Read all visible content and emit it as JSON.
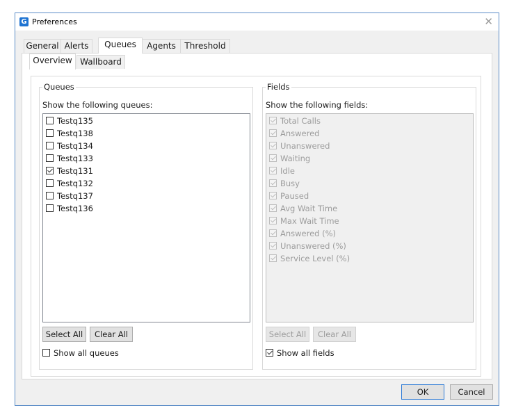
{
  "window": {
    "title": "Preferences",
    "app_icon": "G",
    "close_glyph": "✕"
  },
  "tabs": [
    {
      "label": "General",
      "active": false
    },
    {
      "label": "Alerts",
      "active": false
    },
    {
      "label": "Queues",
      "active": true
    },
    {
      "label": "Agents",
      "active": false
    },
    {
      "label": "Threshold",
      "active": false
    }
  ],
  "subtabs": [
    {
      "label": "Overview",
      "active": true
    },
    {
      "label": "Wallboard",
      "active": false
    }
  ],
  "queues": {
    "group_title": "Queues",
    "hint": "Show the following queues:",
    "items": [
      {
        "label": "Testq135",
        "checked": false
      },
      {
        "label": "Testq138",
        "checked": false
      },
      {
        "label": "Testq134",
        "checked": false
      },
      {
        "label": "Testq133",
        "checked": false
      },
      {
        "label": "Testq131",
        "checked": true
      },
      {
        "label": "Testq132",
        "checked": false
      },
      {
        "label": "Testq137",
        "checked": false
      },
      {
        "label": "Testq136",
        "checked": false
      }
    ],
    "select_all": "Select All",
    "clear_all": "Clear All",
    "show_all_label": "Show all queues",
    "show_all_checked": false
  },
  "fields": {
    "group_title": "Fields",
    "hint": "Show the following fields:",
    "items": [
      {
        "label": "Total Calls",
        "checked": true
      },
      {
        "label": "Answered",
        "checked": true
      },
      {
        "label": "Unanswered",
        "checked": true
      },
      {
        "label": "Waiting",
        "checked": true
      },
      {
        "label": "Idle",
        "checked": true
      },
      {
        "label": "Busy",
        "checked": true
      },
      {
        "label": "Paused",
        "checked": true
      },
      {
        "label": "Avg Wait Time",
        "checked": true
      },
      {
        "label": "Max Wait Time",
        "checked": true
      },
      {
        "label": "Answered (%)",
        "checked": true
      },
      {
        "label": "Unanswered (%)",
        "checked": true
      },
      {
        "label": "Service Level (%)",
        "checked": true
      }
    ],
    "select_all": "Select All",
    "clear_all": "Clear All",
    "show_all_label": "Show all fields",
    "show_all_checked": true
  },
  "footer": {
    "ok": "OK",
    "cancel": "Cancel"
  },
  "colors": {
    "accent": "#2e7bd6",
    "window_border": "#5b8cc7",
    "disabled_text": "#9c9c9c"
  }
}
